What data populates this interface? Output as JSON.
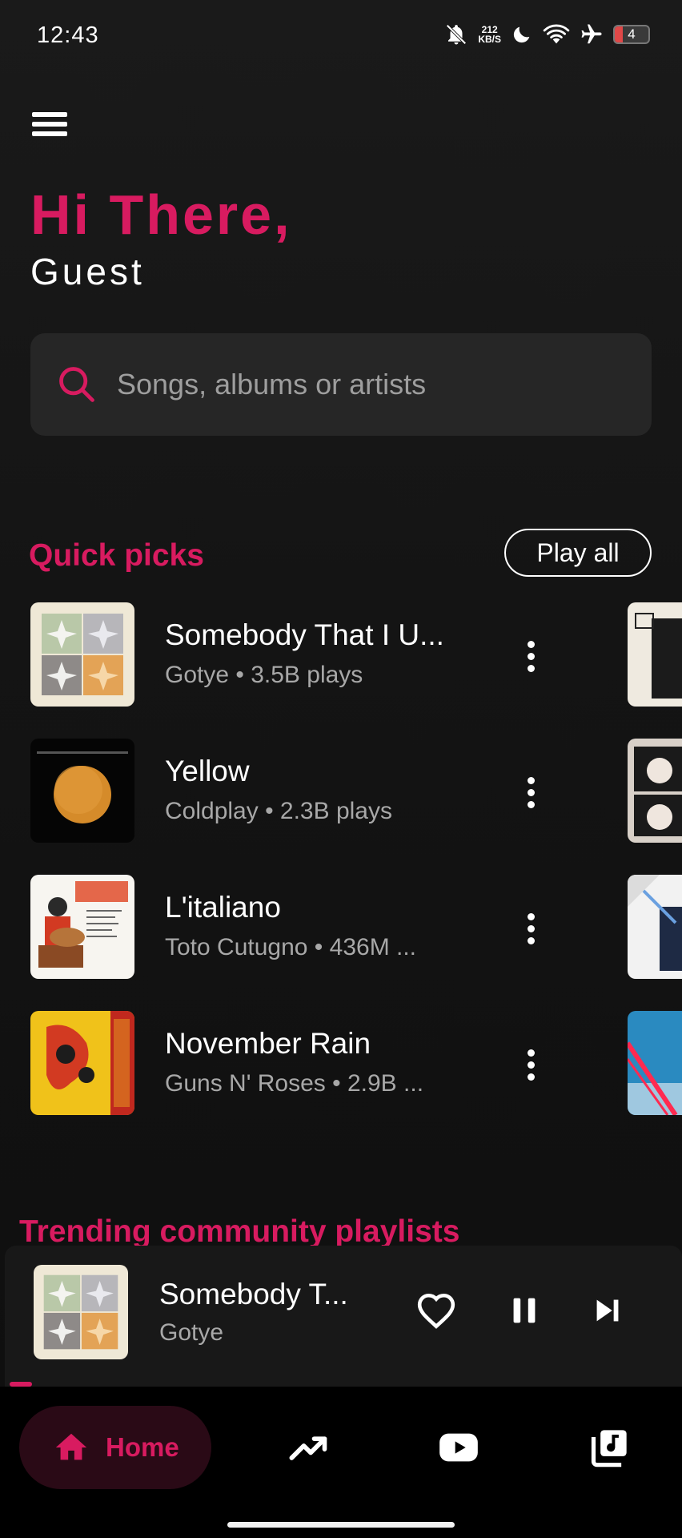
{
  "status_bar": {
    "time": "12:43",
    "net_speed_value": "212",
    "net_speed_unit": "KB/S",
    "battery": "4"
  },
  "header": {
    "greeting": "Hi There,",
    "username": "Guest"
  },
  "search": {
    "placeholder": "Songs, albums or artists"
  },
  "quick_picks": {
    "title": "Quick picks",
    "play_all_label": "Play all",
    "songs": [
      {
        "title": "Somebody That I U...",
        "subtitle": "Gotye • 3.5B plays",
        "cover": "somebody-cover"
      },
      {
        "title": "Yellow",
        "subtitle": "Coldplay • 2.3B plays",
        "cover": "yellow-cover"
      },
      {
        "title": "L'italiano",
        "subtitle": "Toto Cutugno • 436M ...",
        "cover": "litaliano-cover"
      },
      {
        "title": "November Rain",
        "subtitle": "Guns N' Roses • 2.9B ...",
        "cover": "november-rain-cover"
      }
    ]
  },
  "trending": {
    "title": "Trending community playlists"
  },
  "mini_player": {
    "title": "Somebody T...",
    "artist": "Gotye",
    "progress": 0.03
  },
  "nav": {
    "home_label": "Home",
    "items": [
      "home-icon",
      "trending-icon",
      "youtube-icon",
      "library-music-icon"
    ]
  },
  "colors": {
    "accent": "#d81b60",
    "background": "#141414",
    "surface": "#262626"
  }
}
